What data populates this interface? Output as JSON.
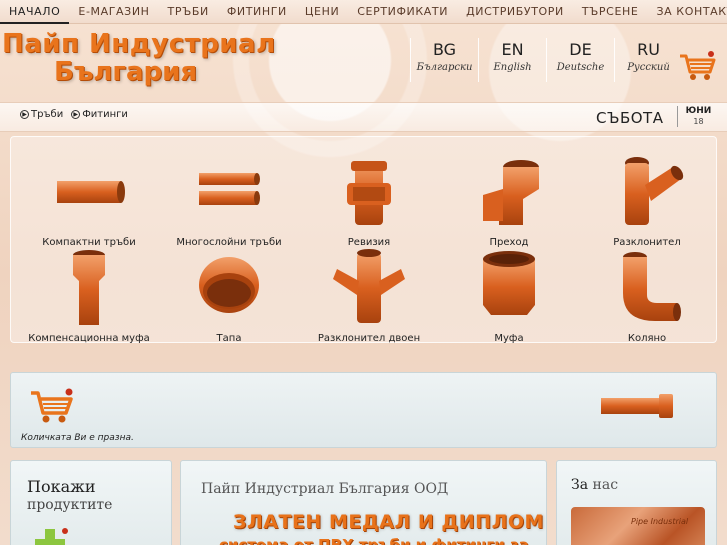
{
  "nav": {
    "items": [
      "НАЧАЛО",
      "Е-МАГАЗИН",
      "ТРЪБИ",
      "ФИТИНГИ",
      "ЦЕНИ",
      "СЕРТИФИКАТИ",
      "ДИСТРИБУТОРИ",
      "ТЪРСЕНЕ",
      "ЗА КОНТАКТИ"
    ],
    "active_index": 0
  },
  "logo": {
    "line1": "Пайп Индустриал",
    "line2": "България"
  },
  "languages": [
    {
      "code": "BG",
      "name": "Български"
    },
    {
      "code": "EN",
      "name": "English"
    },
    {
      "code": "DE",
      "name": "Deutsche"
    },
    {
      "code": "RU",
      "name": "Русский"
    }
  ],
  "breadcrumbs": [
    "Тръби",
    "Фитинги"
  ],
  "date": {
    "weekday": "СЪБОТА",
    "month": "ЮНИ",
    "day": "18"
  },
  "products": [
    {
      "label": "Компактни тръби",
      "icon": "compact-pipe-icon"
    },
    {
      "label": "Многослойни тръби",
      "icon": "multilayer-pipe-icon"
    },
    {
      "label": "Ревизия",
      "icon": "revision-fitting-icon"
    },
    {
      "label": "Преход",
      "icon": "reducer-fitting-icon"
    },
    {
      "label": "Разклонител",
      "icon": "branch-fitting-icon"
    },
    {
      "label": "Компенсационна муфа",
      "icon": "compensation-sleeve-icon"
    },
    {
      "label": "Тапа",
      "icon": "cap-fitting-icon"
    },
    {
      "label": "Разклонител двоен",
      "icon": "double-branch-fitting-icon"
    },
    {
      "label": "Муфа",
      "icon": "sleeve-fitting-icon"
    },
    {
      "label": "Коляно",
      "icon": "elbow-fitting-icon"
    }
  ],
  "cart": {
    "empty_text": "Количката Ви е празна."
  },
  "panels": {
    "show": {
      "line1": "Покажи",
      "line2": "продуктите"
    },
    "company": {
      "name": "Пайп Индустриал България ООД",
      "medal": "ЗЛАТЕН МЕДАЛ И ДИПЛОМ",
      "subtitle": "система от ПВХ тръби и фитинги за"
    },
    "about": {
      "word1": "За",
      "word2": "нас",
      "photo_text": "Pipe Industrial"
    }
  },
  "colors": {
    "accent": "#e9741c",
    "pipe": "#d9601f",
    "nav_text": "#5a3b2a"
  }
}
